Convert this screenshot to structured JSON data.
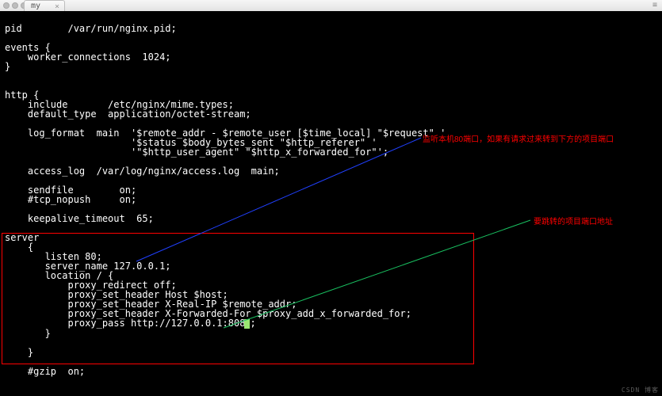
{
  "tab": {
    "title": "my",
    "close": "×"
  },
  "menu_icon": "≡",
  "code_lines": [
    "pid        /var/run/nginx.pid;",
    "",
    "events {",
    "    worker_connections  1024;",
    "}",
    "",
    "",
    "http {",
    "    include       /etc/nginx/mime.types;",
    "    default_type  application/octet-stream;",
    "",
    "    log_format  main  '$remote_addr - $remote_user [$time_local] \"$request\" '",
    "                      '$status $body_bytes_sent \"$http_referer\" '",
    "                      '\"$http_user_agent\" \"$http_x_forwarded_for\"';",
    "",
    "    access_log  /var/log/nginx/access.log  main;",
    "",
    "    sendfile        on;",
    "    #tcp_nopush     on;",
    "",
    "    keepalive_timeout  65;",
    "",
    "server",
    "    {",
    "       listen 80;",
    "       server_name 127.0.0.1;",
    "       location / {",
    "           proxy_redirect off;",
    "           proxy_set_header Host $host;",
    "           proxy_set_header X-Real-IP $remote_addr;",
    "           proxy_set_header X-Forwarded-For $proxy_add_x_forwarded_for;",
    "           proxy_pass http://127.0.0.1:808",
    "       }",
    "",
    "    }",
    "",
    "    #gzip  on;"
  ],
  "cursor_tail": ";",
  "annotations": {
    "top": "监听本机80端口，如果有请求过来转到下方的项目端口",
    "bottom": "要跳转的项目端口地址"
  },
  "watermark": "CSDN  博客"
}
